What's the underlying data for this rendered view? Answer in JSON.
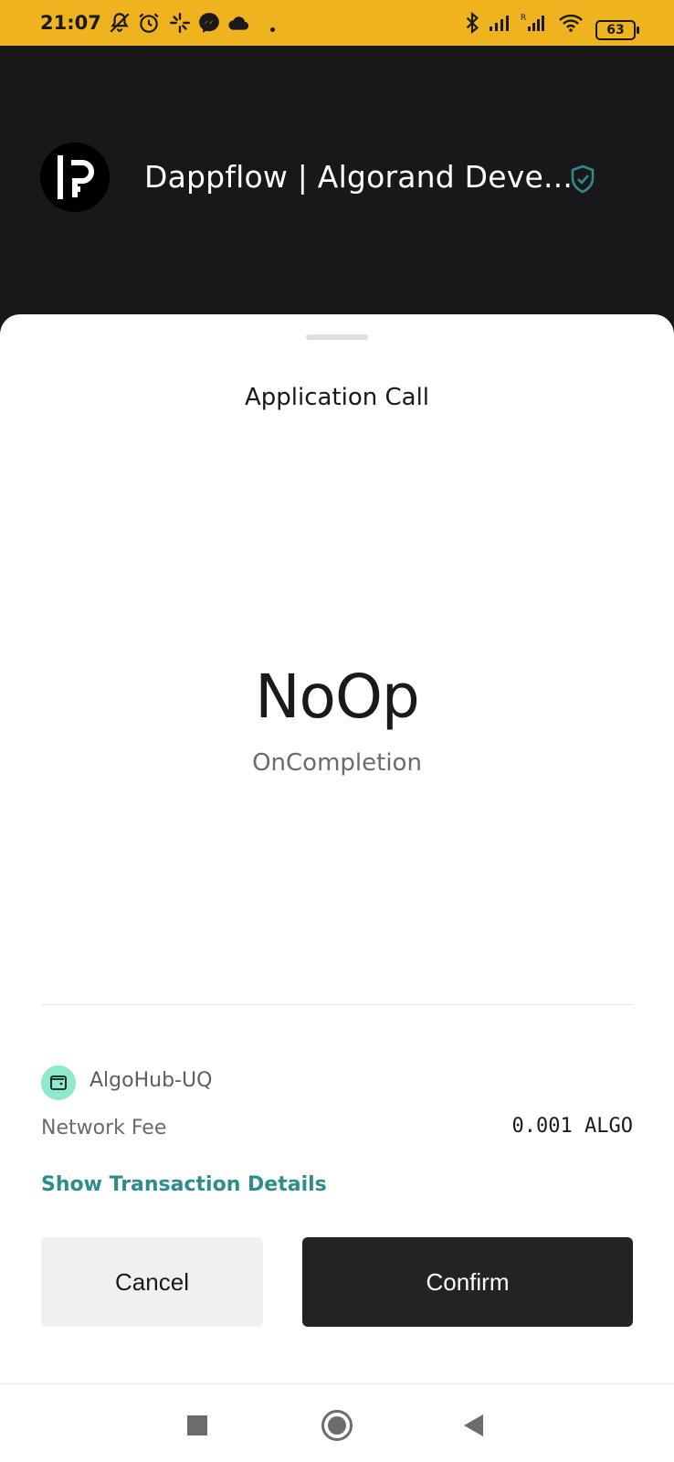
{
  "status_bar": {
    "time": "21:07",
    "battery": "63",
    "icons": [
      "notifications-muted-icon",
      "alarm-icon",
      "activity-icon",
      "messenger-icon",
      "cloud-icon",
      "bluetooth-icon",
      "signal-icon",
      "roaming-signal-icon",
      "wifi-icon",
      "battery-icon"
    ]
  },
  "app_header": {
    "title": "Dappflow | Algorand Deve...",
    "logo_icon": "dappflow-logo",
    "verified_icon": "verified-shield-icon",
    "verified_color": "#2e8c8c"
  },
  "sheet": {
    "title": "Application Call",
    "main_value": "NoOp",
    "main_caption": "OnCompletion",
    "account": {
      "name": "AlgoHub-UQ",
      "avatar_icon": "wallet-icon",
      "avatar_color": "#8ee9cf"
    },
    "fee": {
      "label": "Network Fee",
      "value": "0.001 ALGO"
    },
    "details_link": "Show Transaction Details",
    "buttons": {
      "cancel": "Cancel",
      "confirm": "Confirm"
    }
  },
  "nav_bar": {
    "icons": [
      "recents-icon",
      "home-icon",
      "back-icon"
    ]
  },
  "colors": {
    "status_bar_bg": "#efb320",
    "header_bg": "#18181b",
    "accent_link": "#2e8c8c",
    "confirm_bg": "#232325",
    "cancel_bg": "#f0f0f0"
  }
}
